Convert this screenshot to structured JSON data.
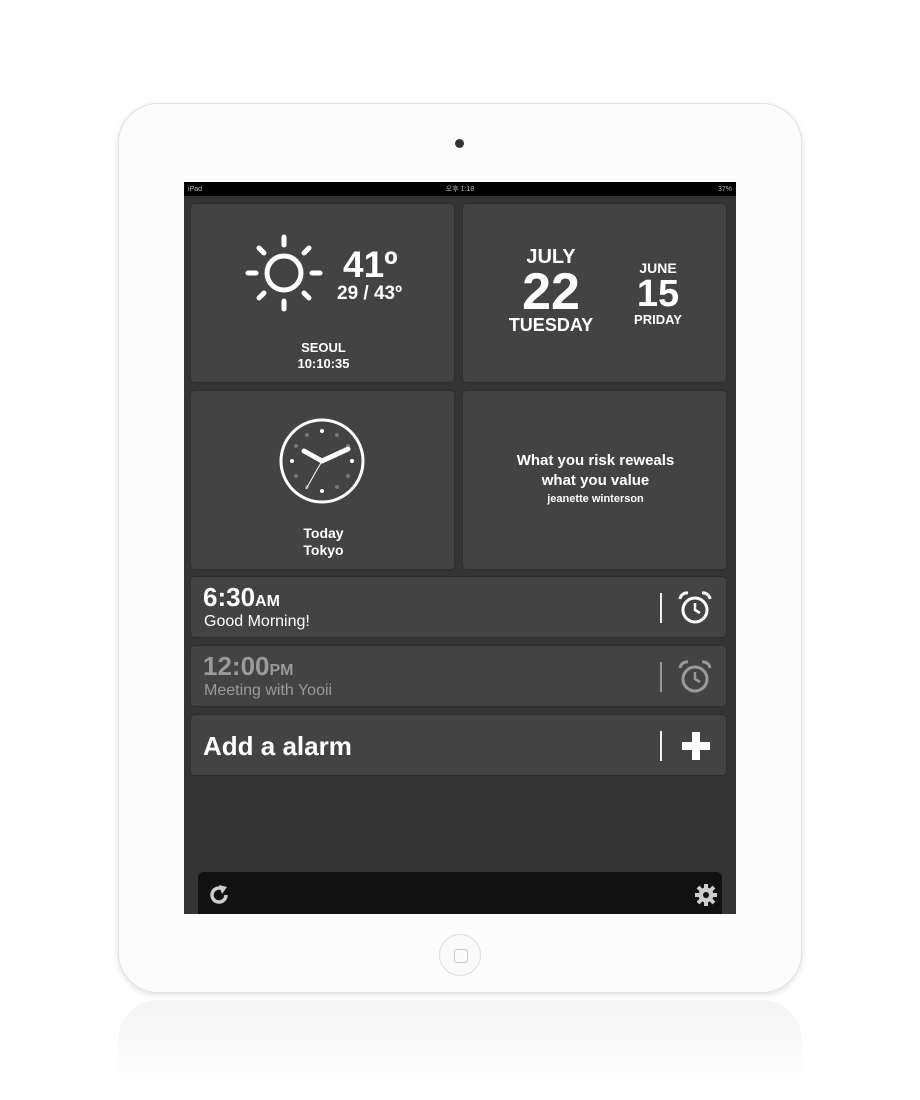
{
  "status_bar": {
    "device": "iPad",
    "time": "오후 1:18",
    "battery": "37%"
  },
  "weather": {
    "temp": "41º",
    "range": "29 / 43º",
    "city": "SEOUL",
    "time": "10:10:35"
  },
  "calendar": {
    "primary": {
      "month": "JULY",
      "day": "22",
      "weekday": "TUESDAY"
    },
    "secondary": {
      "month": "JUNE",
      "day": "15",
      "weekday": "PRIDAY"
    }
  },
  "world_clock": {
    "line1": "Today",
    "line2": "Tokyo"
  },
  "quote": {
    "line1": "What you risk reweals",
    "line2": "what you value",
    "author": "jeanette winterson"
  },
  "alarms": [
    {
      "time": "6:30",
      "ampm": "AM",
      "label": "Good Morning!",
      "active": true
    },
    {
      "time": "12:00",
      "ampm": "PM",
      "label": "Meeting with Yooii",
      "active": false
    }
  ],
  "add_alarm": {
    "label": "Add a alarm"
  },
  "colors": {
    "tile": "#434343",
    "screen": "#343434",
    "inactive": "#9a9a9a"
  }
}
